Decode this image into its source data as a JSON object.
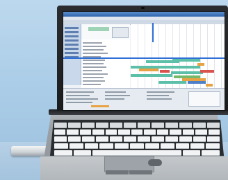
{
  "scene": {
    "background_color": "#a9cbe6",
    "device": "laptop",
    "accessory": "usb-stick"
  },
  "application": {
    "view": "gantt-schedule",
    "accent_color": "#2f6fd6",
    "bar_colors": {
      "teal": "#5cc0a8",
      "orange": "#e9a243",
      "red": "#d9534f",
      "blue": "#4f7fc7",
      "green": "#77b96a"
    }
  }
}
